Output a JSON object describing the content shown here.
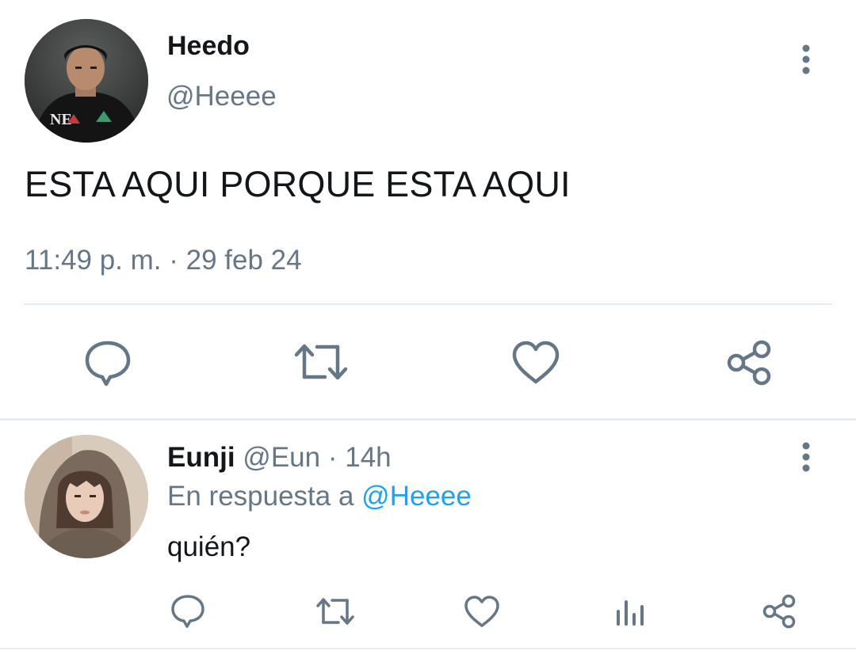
{
  "colors": {
    "text": "#14171a",
    "muted": "#657786",
    "link": "#1da1f2",
    "divider": "#e6ecf0",
    "icon": "#657786"
  },
  "main_tweet": {
    "display_name": "Heedo",
    "handle": "@Heeee",
    "text": "ESTA AQUI PORQUE ESTA AQUI",
    "time": "11:49 p. m.",
    "separator": "·",
    "date": "29 feb 24",
    "avatar_text": "NE",
    "actions": [
      "reply-icon",
      "retweet-icon",
      "like-icon",
      "share-icon"
    ]
  },
  "reply": {
    "display_name": "Eunji",
    "handle": "@Eun",
    "separator": "·",
    "age": "14h",
    "reply_prefix": "En respuesta a",
    "reply_to": "@Heeee",
    "text": "quién?",
    "actions": [
      "reply-icon",
      "retweet-icon",
      "like-icon",
      "analytics-icon",
      "share-icon"
    ]
  }
}
